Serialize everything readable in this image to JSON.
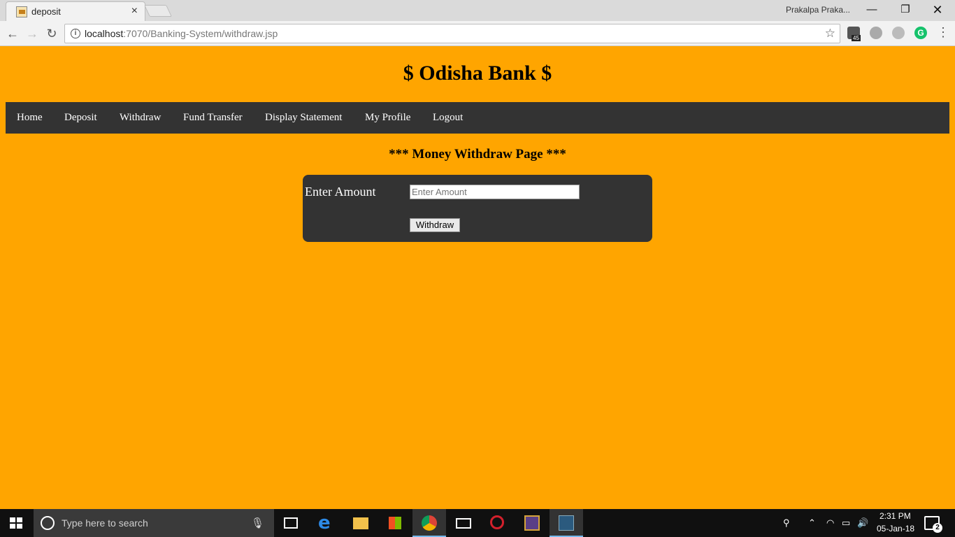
{
  "browser": {
    "tab_title": "deposit",
    "tab_close": "×",
    "profile_name": "Prakalpa Praka...",
    "url_host": "localhost",
    "url_rest": ":7070/Banking-System/withdraw.jsp",
    "extension_badge": "45",
    "window_controls": {
      "minimize": "—",
      "maximize": "❐",
      "close": "✕"
    }
  },
  "page": {
    "bank_title": "$ Odisha Bank $",
    "nav": [
      {
        "label": "Home"
      },
      {
        "label": "Deposit"
      },
      {
        "label": "Withdraw"
      },
      {
        "label": "Fund Transfer"
      },
      {
        "label": "Display Statement"
      },
      {
        "label": "My Profile"
      },
      {
        "label": "Logout"
      }
    ],
    "heading": "*** Money Withdraw Page ***",
    "form": {
      "amount_label": "Enter Amount",
      "amount_value": "",
      "amount_placeholder": "Enter Amount",
      "submit_label": "Withdraw"
    },
    "colors": {
      "background": "#ffa500",
      "navbar": "#333333",
      "form_box": "#333333"
    }
  },
  "taskbar": {
    "search_placeholder": "Type here to search",
    "apps": [
      "task-view",
      "edge",
      "file-explorer",
      "store",
      "chrome",
      "mail",
      "antivirus",
      "app-ide",
      "mysql-workbench"
    ],
    "time": "2:31 PM",
    "date": "05-Jan-18",
    "notification_count": "2"
  }
}
